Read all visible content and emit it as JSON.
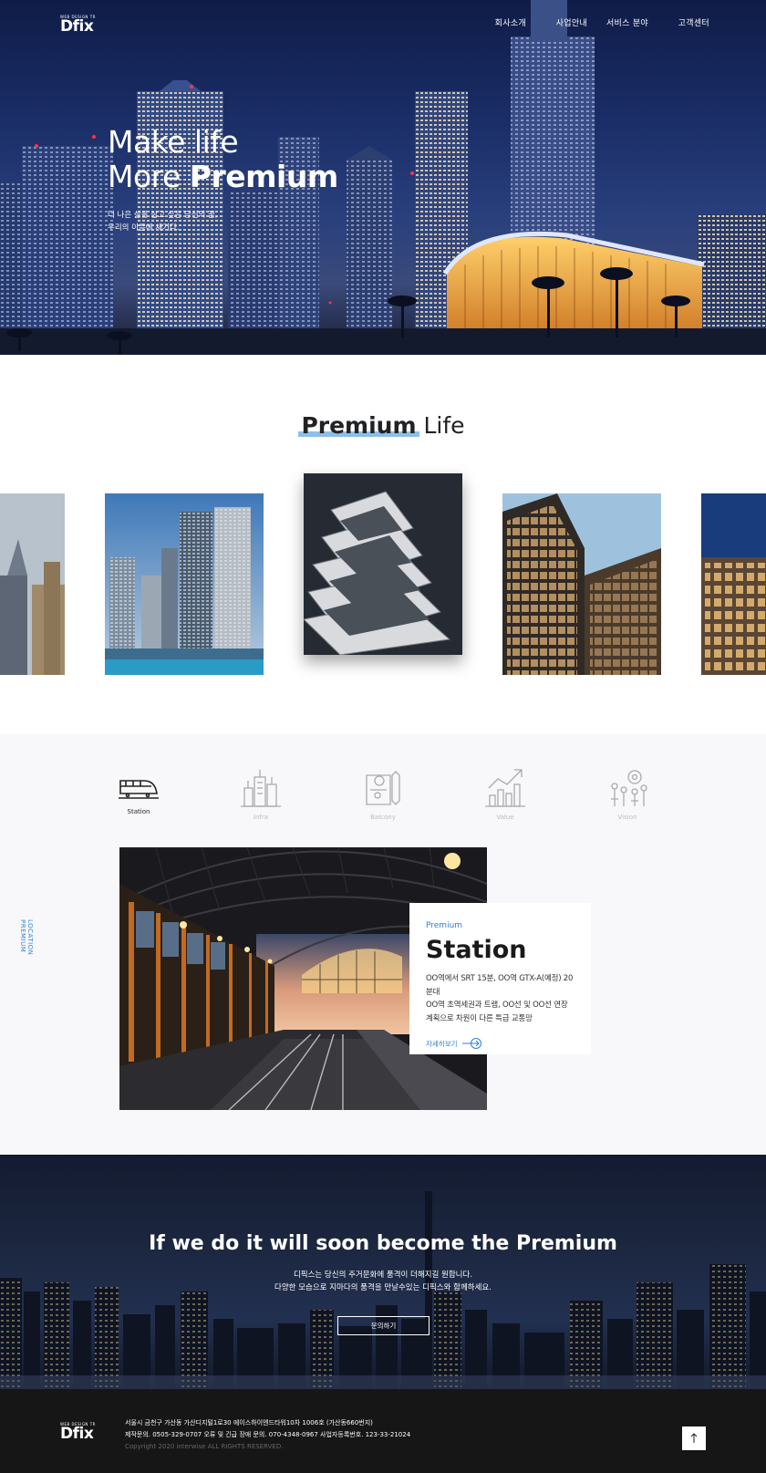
{
  "header": {
    "logo_small": "WEB DESIGN TR",
    "logo_big": "Dfix",
    "nav": [
      "회사소개",
      "사업안내",
      "서비스 분야",
      "고객센터"
    ]
  },
  "hero": {
    "line1": "Make life",
    "line2_prefix": "More ",
    "line2_bold": "Premium",
    "sub1": "더 나은 삶을 살고 싶은 당신의 꿈,",
    "sub2": "우리의 이름에 새기다."
  },
  "premium_life": {
    "title_bold": "Premium",
    "title_light": " Life"
  },
  "location": {
    "vertical_label": "LOCATION PREMIUM",
    "tabs": [
      {
        "label": "Station",
        "icon": "train-icon",
        "active": true
      },
      {
        "label": "Infra",
        "icon": "city-buildings-icon",
        "active": false
      },
      {
        "label": "Balcony",
        "icon": "blueprint-icon",
        "active": false
      },
      {
        "label": "Value",
        "icon": "growth-chart-icon",
        "active": false
      },
      {
        "label": "Vision",
        "icon": "vision-network-icon",
        "active": false
      }
    ],
    "card": {
      "kicker": "Premium",
      "title": "Station",
      "desc1": "OO역에서 SRT 15분, OO역 GTX-A(예정) 20분대",
      "desc2": "OO역 초역세권과 트램, OO선 및 OO선 연장",
      "desc3": "계획으로 차원이 다른 특급 교통망",
      "more": "자세히보기"
    }
  },
  "banner": {
    "title_prefix": "If we do it will soon become the ",
    "title_bold": "Premium",
    "desc1": "디픽스는 당신의 주거문화에 품격이 더해지길 원합니다.",
    "desc2": "다양한 모습으로 지마다의 품격을 만날수있는 디픽스와 함께하세요.",
    "button": "문의하기"
  },
  "footer": {
    "logo_small": "WEB DESIGN TR",
    "logo_big": "Dfix",
    "address": "서울시 금천구 가산동 가산디지털1로30 에이스하이엔드타워10차 1006호 (가산동660번지)",
    "contacts": "제작문의. 0505-329-0707    오류 및 긴급 장애 문의. 070-4348-0967    사업자등록번호. 123-33-21024",
    "copyright": "Copyright 2020 interwise ALL RIGHTS RESERVED.",
    "top_icon": "arrow-up-icon"
  },
  "colors": {
    "accent": "#2d7fd8",
    "accent_light": "#8cc0ea",
    "footer_bg": "#161616",
    "section_bg": "#f8f8fa"
  }
}
